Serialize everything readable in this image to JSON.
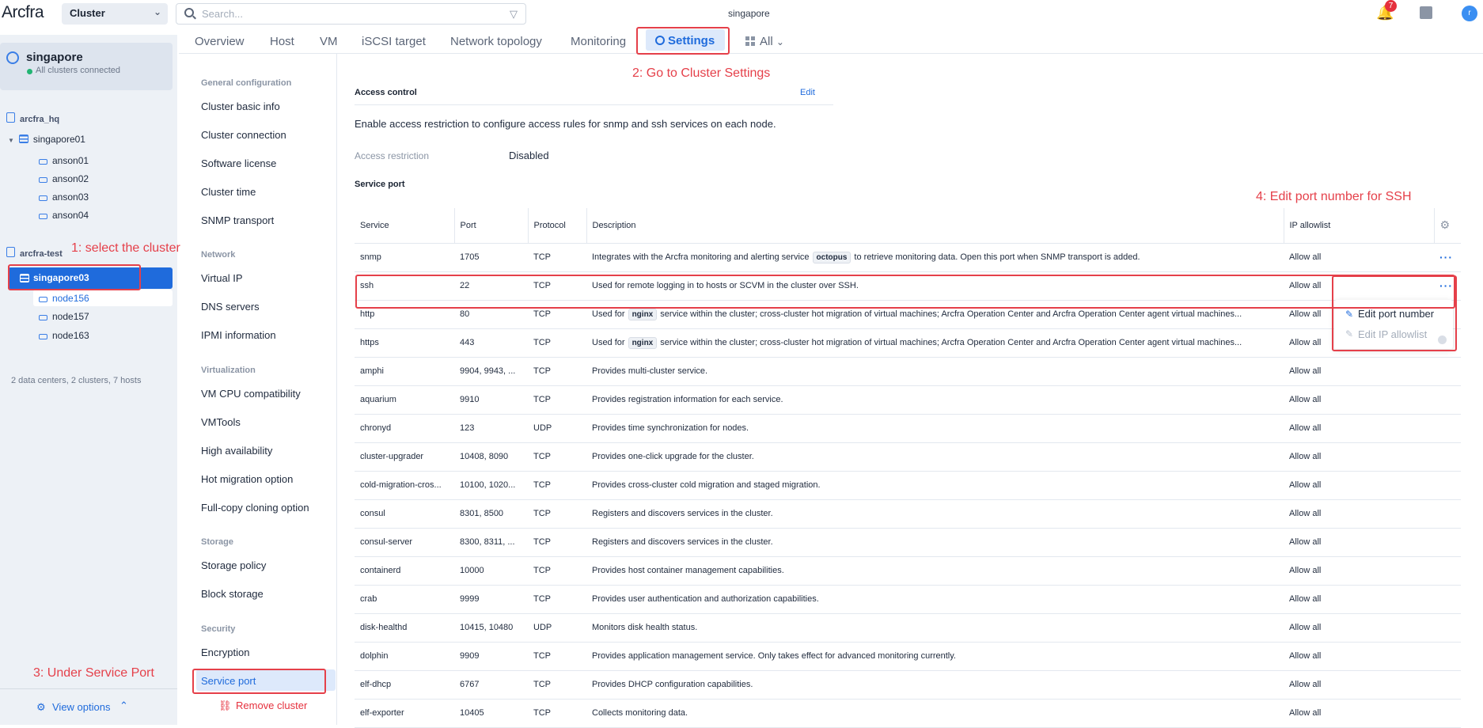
{
  "app": {
    "logo": "Arcfra",
    "scope_selector": "Cluster",
    "search_placeholder": "Search...",
    "current_cluster": "singapore",
    "notifications_count": "7",
    "avatar_letter": "r"
  },
  "sidebar": {
    "cluster_name": "singapore",
    "cluster_status": "All clusters connected",
    "datacenter1": "arcfra_hq",
    "cluster1": "singapore01",
    "cluster1_hosts": [
      "anson01",
      "anson02",
      "anson03",
      "anson04"
    ],
    "datacenter2": "arcfra-test",
    "cluster2": "singapore03",
    "cluster2_hosts": [
      "node156",
      "node157",
      "node163"
    ],
    "summary": "2 data centers, 2 clusters, 7 hosts",
    "view_options": "View options"
  },
  "tabs": [
    "Overview",
    "Host",
    "VM",
    "iSCSI target",
    "Network topology",
    "Monitoring",
    "Settings",
    "All"
  ],
  "settings_nav": {
    "general_title": "General configuration",
    "general_items": [
      "Cluster basic info",
      "Cluster connection",
      "Software license",
      "Cluster time",
      "SNMP transport"
    ],
    "network_title": "Network",
    "network_items": [
      "Virtual IP",
      "DNS servers",
      "IPMI information"
    ],
    "virtualization_title": "Virtualization",
    "virtualization_items": [
      "VM CPU compatibility",
      "VMTools",
      "High availability",
      "Hot migration option",
      "Full-copy cloning option"
    ],
    "storage_title": "Storage",
    "storage_items": [
      "Storage policy",
      "Block storage"
    ],
    "security_title": "Security",
    "security_items": [
      "Encryption",
      "Service port"
    ],
    "remove_cluster": "Remove cluster"
  },
  "access_control": {
    "title": "Access control",
    "edit": "Edit",
    "description": "Enable access restriction to configure access rules for snmp and ssh services on each node.",
    "restriction_label": "Access restriction",
    "restriction_value": "Disabled"
  },
  "service_port": {
    "title": "Service port",
    "columns": [
      "Service",
      "Port",
      "Protocol",
      "Description",
      "IP allowlist"
    ],
    "rows": [
      {
        "service": "snmp",
        "port": "1705",
        "protocol": "TCP",
        "desc_pre": "Integrates with the Arcfra monitoring and alerting service",
        "code": "octopus",
        "desc_post": "to retrieve monitoring data. Open this port when SNMP transport is added.",
        "allowlist": "Allow all"
      },
      {
        "service": "ssh",
        "port": "22",
        "protocol": "TCP",
        "desc_pre": "Used for remote logging in to hosts or SCVM in the cluster over SSH.",
        "code": "",
        "desc_post": "",
        "allowlist": "Allow all"
      },
      {
        "service": "http",
        "port": "80",
        "protocol": "TCP",
        "desc_pre": "Used for",
        "code": "nginx",
        "desc_post": "service within the cluster; cross-cluster hot migration of virtual machines; Arcfra Operation Center and Arcfra Operation Center agent virtual machines...",
        "allowlist": "Allow all"
      },
      {
        "service": "https",
        "port": "443",
        "protocol": "TCP",
        "desc_pre": "Used for",
        "code": "nginx",
        "desc_post": "service within the cluster; cross-cluster hot migration of virtual machines; Arcfra Operation Center and Arcfra Operation Center agent virtual machines...",
        "allowlist": "Allow all"
      },
      {
        "service": "amphi",
        "port": "9904, 9943, ...",
        "protocol": "TCP",
        "desc_pre": "Provides multi-cluster service.",
        "code": "",
        "desc_post": "",
        "allowlist": "Allow all"
      },
      {
        "service": "aquarium",
        "port": "9910",
        "protocol": "TCP",
        "desc_pre": "Provides registration information for each service.",
        "code": "",
        "desc_post": "",
        "allowlist": "Allow all"
      },
      {
        "service": "chronyd",
        "port": "123",
        "protocol": "UDP",
        "desc_pre": "Provides time synchronization for nodes.",
        "code": "",
        "desc_post": "",
        "allowlist": "Allow all"
      },
      {
        "service": "cluster-upgrader",
        "port": "10408, 8090",
        "protocol": "TCP",
        "desc_pre": "Provides one-click upgrade for the cluster.",
        "code": "",
        "desc_post": "",
        "allowlist": "Allow all"
      },
      {
        "service": "cold-migration-cros...",
        "port": "10100, 1020...",
        "protocol": "TCP",
        "desc_pre": "Provides cross-cluster cold migration and staged migration.",
        "code": "",
        "desc_post": "",
        "allowlist": "Allow all"
      },
      {
        "service": "consul",
        "port": "8301, 8500",
        "protocol": "TCP",
        "desc_pre": "Registers and discovers services in the cluster.",
        "code": "",
        "desc_post": "",
        "allowlist": "Allow all"
      },
      {
        "service": "consul-server",
        "port": "8300, 8311, ...",
        "protocol": "TCP",
        "desc_pre": "Registers and discovers services in the cluster.",
        "code": "",
        "desc_post": "",
        "allowlist": "Allow all"
      },
      {
        "service": "containerd",
        "port": "10000",
        "protocol": "TCP",
        "desc_pre": "Provides host container management capabilities.",
        "code": "",
        "desc_post": "",
        "allowlist": "Allow all"
      },
      {
        "service": "crab",
        "port": "9999",
        "protocol": "TCP",
        "desc_pre": "Provides user authentication and authorization capabilities.",
        "code": "",
        "desc_post": "",
        "allowlist": "Allow all"
      },
      {
        "service": "disk-healthd",
        "port": "10415, 10480",
        "protocol": "UDP",
        "desc_pre": "Monitors disk health status.",
        "code": "",
        "desc_post": "",
        "allowlist": "Allow all"
      },
      {
        "service": "dolphin",
        "port": "9909",
        "protocol": "TCP",
        "desc_pre": "Provides application management service. Only takes effect for advanced monitoring currently.",
        "code": "",
        "desc_post": "",
        "allowlist": "Allow all"
      },
      {
        "service": "elf-dhcp",
        "port": "6767",
        "protocol": "TCP",
        "desc_pre": "Provides DHCP configuration capabilities.",
        "code": "",
        "desc_post": "",
        "allowlist": "Allow all"
      },
      {
        "service": "elf-exporter",
        "port": "10405",
        "protocol": "TCP",
        "desc_pre": "Collects monitoring data.",
        "code": "",
        "desc_post": "",
        "allowlist": "Allow all"
      }
    ]
  },
  "row_menu": {
    "edit_port": "Edit port number",
    "edit_allowlist": "Edit IP allowlist"
  },
  "annotations": {
    "step1": "1: select the cluster",
    "step2": "2: Go to Cluster Settings",
    "step3": "3: Under Service Port",
    "step4": "4: Edit port number for SSH"
  },
  "colors": {
    "accent": "#1f6bdc",
    "annotation": "#e5404a",
    "sidebar_bg": "#edf1f6"
  }
}
